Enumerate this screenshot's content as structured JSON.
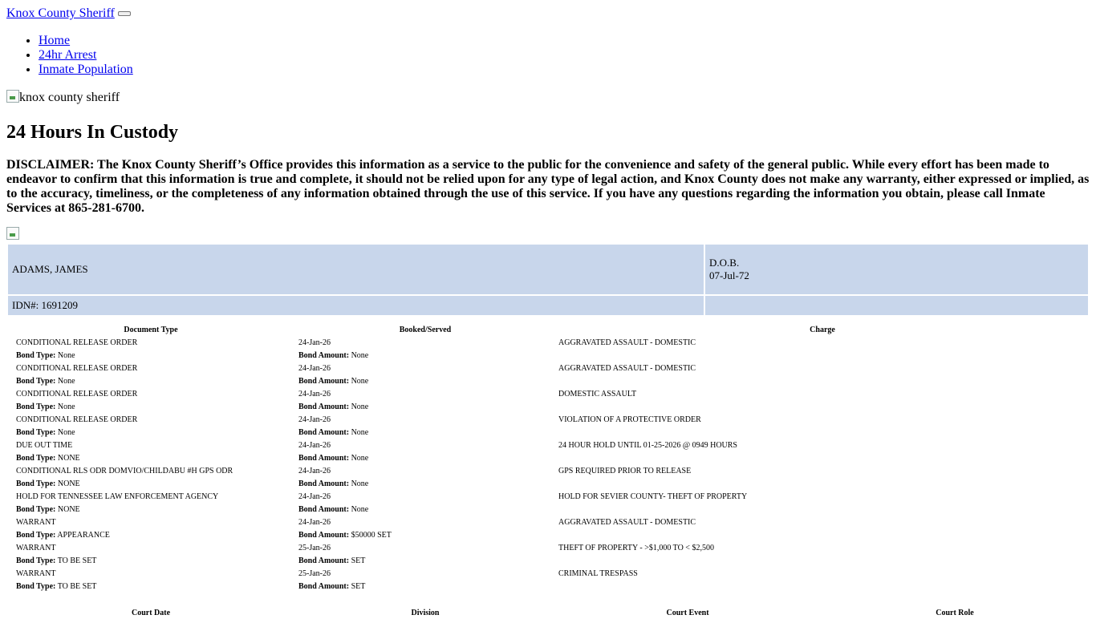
{
  "header": {
    "brand": "Knox County Sheriff",
    "nav": [
      "Home",
      "24hr Arrest",
      "Inmate Population"
    ],
    "logo_alt": "knox county sheriff"
  },
  "page": {
    "title": "24 Hours In Custody",
    "disclaimer": "DISCLAIMER: The Knox County Sheriff’s Office provides this information as a service to the public for the convenience and safety of the general public. While every effort has been made to endeavor to confirm that this information is true and complete, it should not be relied upon for any type of legal action, and Knox County does not make any warranty, either expressed or implied, as to the accuracy, timeliness, or the completeness of any information obtained through the use of this service. If you have any questions regarding the information you obtain, please call Inmate Services at 865-281-6700."
  },
  "person": {
    "name": "ADAMS, JAMES",
    "dob_label": "D.O.B.",
    "dob": "07-Jul-72",
    "idn": "IDN#: 1691209"
  },
  "charges_table": {
    "headers": [
      "Document Type",
      "Booked/Served",
      "Charge"
    ],
    "bond_type_label": "Bond Type:",
    "bond_amount_label": "Bond Amount:",
    "rows": [
      {
        "doc": "CONDITIONAL RELEASE ORDER",
        "booked": "24-Jan-26",
        "charge": "AGGRAVATED ASSAULT - DOMESTIC",
        "bond_type": "None",
        "bond_amount": "None"
      },
      {
        "doc": "CONDITIONAL RELEASE ORDER",
        "booked": "24-Jan-26",
        "charge": "AGGRAVATED ASSAULT - DOMESTIC",
        "bond_type": "None",
        "bond_amount": "None"
      },
      {
        "doc": "CONDITIONAL RELEASE ORDER",
        "booked": "24-Jan-26",
        "charge": "DOMESTIC ASSAULT",
        "bond_type": "None",
        "bond_amount": "None"
      },
      {
        "doc": "CONDITIONAL RELEASE ORDER",
        "booked": "24-Jan-26",
        "charge": "VIOLATION OF A PROTECTIVE ORDER",
        "bond_type": "None",
        "bond_amount": "None"
      },
      {
        "doc": "DUE OUT TIME",
        "booked": "24-Jan-26",
        "charge": "24 HOUR HOLD UNTIL 01-25-2026 @ 0949 HOURS",
        "bond_type": "NONE",
        "bond_amount": "None"
      },
      {
        "doc": "CONDITIONAL RLS ODR DOMVIO/CHILDABU #H GPS ODR",
        "booked": "24-Jan-26",
        "charge": "GPS REQUIRED PRIOR TO RELEASE",
        "bond_type": "NONE",
        "bond_amount": "None"
      },
      {
        "doc": "HOLD FOR TENNESSEE LAW ENFORCEMENT AGENCY",
        "booked": "24-Jan-26",
        "charge": "HOLD FOR SEVIER COUNTY- THEFT OF PROPERTY",
        "bond_type": "NONE",
        "bond_amount": "None"
      },
      {
        "doc": "WARRANT",
        "booked": "24-Jan-26",
        "charge": "AGGRAVATED ASSAULT - DOMESTIC",
        "bond_type": "APPEARANCE",
        "bond_amount": "$50000 SET"
      },
      {
        "doc": "WARRANT",
        "booked": "25-Jan-26",
        "charge": "THEFT OF PROPERTY - >$1,000 TO < $2,500",
        "bond_type": "TO BE SET",
        "bond_amount": "SET"
      },
      {
        "doc": "WARRANT",
        "booked": "25-Jan-26",
        "charge": "CRIMINAL TRESPASS",
        "bond_type": "TO BE SET",
        "bond_amount": "SET"
      }
    ]
  },
  "court_table": {
    "headers": [
      "Court Date",
      "Division",
      "Court Event",
      "Court Role"
    ]
  }
}
